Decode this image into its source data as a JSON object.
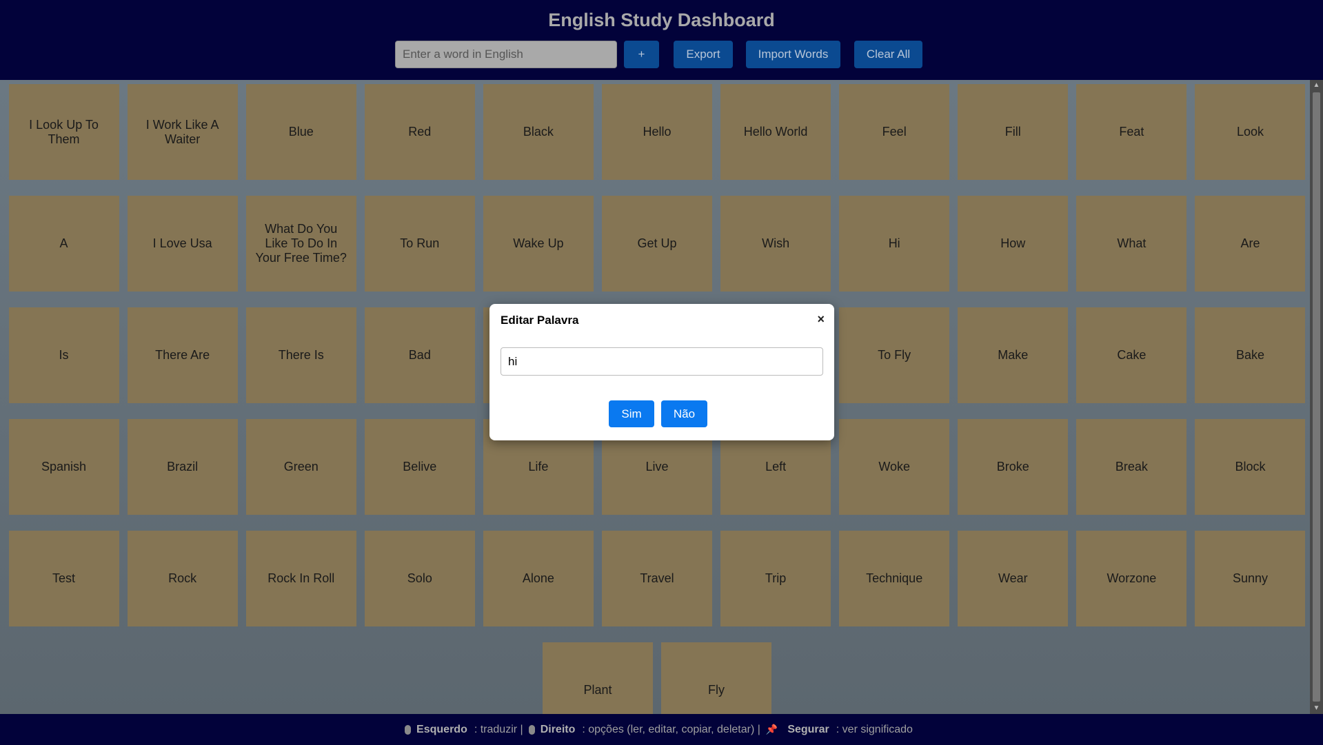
{
  "header": {
    "title": "English Study Dashboard",
    "input_placeholder": "Enter a word in English",
    "add_label": "+",
    "export_label": "Export",
    "import_label": "Import Words",
    "clear_label": "Clear All"
  },
  "words": [
    "I Look Up To Them",
    "I Work Like A Waiter",
    "Blue",
    "Red",
    "Black",
    "Hello",
    "Hello World",
    "Feel",
    "Fill",
    "Feat",
    "Look",
    "A",
    "I Love Usa",
    "What Do You Like To Do In Your Free Time?",
    "To Run",
    "Wake Up",
    "Get Up",
    "Wish",
    "Hi",
    "How",
    "What",
    "Are",
    "Is",
    "There Are",
    "There Is",
    "Bad",
    "",
    "",
    "",
    "To Fly",
    "Make",
    "Cake",
    "Bake",
    "Spanish",
    "Brazil",
    "Green",
    "Belive",
    "Life",
    "Live",
    "Left",
    "Woke",
    "Broke",
    "Break",
    "Block",
    "Test",
    "Rock",
    "Rock In Roll",
    "Solo",
    "Alone",
    "Travel",
    "Trip",
    "Technique",
    "Wear",
    "Worzone",
    "Sunny",
    "Plant",
    "Fly"
  ],
  "modal": {
    "title": "Editar Palavra",
    "close": "×",
    "input_value": "hi",
    "yes_label": "Sim",
    "no_label": "Não"
  },
  "footer": {
    "left_label": "Esquerdo",
    "left_text": ": traduzir |",
    "right_label": "Direito",
    "right_text": ": opções (ler, editar, copiar, deletar) |",
    "hold_label": "Segurar",
    "hold_text": ": ver significado"
  },
  "colors": {
    "header_bg": "#02023a",
    "card_bg": "#857554",
    "button_bg": "#0b4a91",
    "modal_button": "#0a79f0"
  }
}
